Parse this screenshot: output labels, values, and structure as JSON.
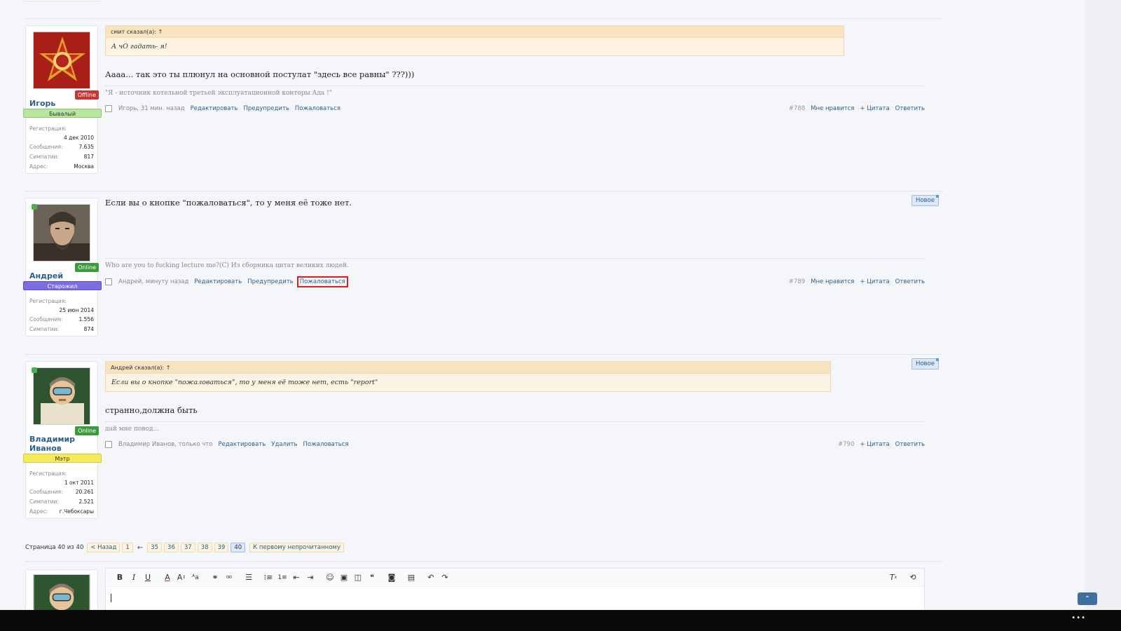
{
  "posts": [
    {
      "user": {
        "name": "Игорь",
        "status": "Offline",
        "rank": "Бывалый",
        "stats": [
          {
            "label": "Регистрация:",
            "value": "4 дек 2010"
          },
          {
            "label": "Сообщения:",
            "value": "7.635"
          },
          {
            "label": "Симпатии:",
            "value": "817"
          },
          {
            "label": "Адрес:",
            "value": "Москва"
          }
        ]
      },
      "quote": {
        "header": "смит сказал(а): ↑",
        "text": "А чО гадать- я!"
      },
      "message": "Аааа... так это ты плюнул на основной постулат \"здесь все равны\" ???)))",
      "signature": "\"Я - источник котельной третьей эксплуатационной конторы Ада !\"",
      "meta": {
        "author_time": "Игорь, 31 мин. назад",
        "edit": "Редактировать",
        "warn": "Предупредить",
        "report": "Пожаловаться"
      },
      "meta_right": {
        "number": "#788",
        "like": "Мне нравится",
        "quote": "+ Цитата",
        "reply": "Ответить"
      }
    },
    {
      "user": {
        "name": "Андрей",
        "status": "Online",
        "rank": "Старожил",
        "stats": [
          {
            "label": "Регистрация:",
            "value": "25 июн 2014"
          },
          {
            "label": "Сообщения:",
            "value": "1.556"
          },
          {
            "label": "Симпатии:",
            "value": "874"
          }
        ]
      },
      "new_badge": "Новое",
      "message": "Если вы о кнопке \"пожаловаться\", то у меня её тоже нет.",
      "signature": "Who are you to fucking lecture me?(С) Из сборника цитат великих людей.",
      "meta": {
        "author_time": "Андрей, минуту назад",
        "edit": "Редактировать",
        "warn": "Предупредить",
        "report": "Пожаловаться"
      },
      "meta_right": {
        "number": "#789",
        "like": "Мне нравится",
        "quote": "+ Цитата",
        "reply": "Ответить"
      }
    },
    {
      "user": {
        "name": "Владимир Иванов",
        "status": "Online",
        "rank": "Мэтр",
        "stats": [
          {
            "label": "Регистрация:",
            "value": "1 окт 2011"
          },
          {
            "label": "Сообщения:",
            "value": "20.261"
          },
          {
            "label": "Симпатии:",
            "value": "2.521"
          },
          {
            "label": "Адрес:",
            "value": "г.Чебоксары"
          }
        ]
      },
      "new_badge": "Новое",
      "quote": {
        "header": "Андрей сказал(а): ↑",
        "text": "Если вы о кнопке \"пожаловаться\", то у меня её тоже нет, есть \"report\""
      },
      "message": "странно,должна быть",
      "signature": "дай мне повод...",
      "meta": {
        "author_time": "Владимир Иванов, только что",
        "edit": "Редактировать",
        "delete": "Удалить",
        "report": "Пожаловаться"
      },
      "meta_right": {
        "number": "#790",
        "quote": "+ Цитата",
        "reply": "Ответить"
      }
    }
  ],
  "pagination": {
    "label": "Страница 40 из 40",
    "prev": "< Назад",
    "first": "1",
    "arrow": "←",
    "pages": [
      "35",
      "36",
      "37",
      "38",
      "39",
      "40"
    ],
    "current": "40",
    "unread": "К первому непрочитанному"
  },
  "editor": {
    "toolbar_icons": [
      "bold-icon",
      "italic-icon",
      "underline-icon",
      "font-color-icon",
      "font-size-icon",
      "font-family-icon",
      "link-icon",
      "unlink-icon",
      "align-icon",
      "bullet-list-icon",
      "numbered-list-icon",
      "outdent-icon",
      "indent-icon",
      "smiley-icon",
      "image-icon",
      "media-icon",
      "quote-icon",
      "camera-icon",
      "save-draft-icon",
      "undo-icon",
      "redo-icon",
      "remove-format-icon",
      "toggle-bbcode-icon"
    ]
  },
  "colors": {
    "link": "#2b5f8a",
    "offline": "#c83535",
    "online": "#3b9b3b",
    "highlight": "#d92020",
    "quote_bg": "#fdf3e2"
  }
}
